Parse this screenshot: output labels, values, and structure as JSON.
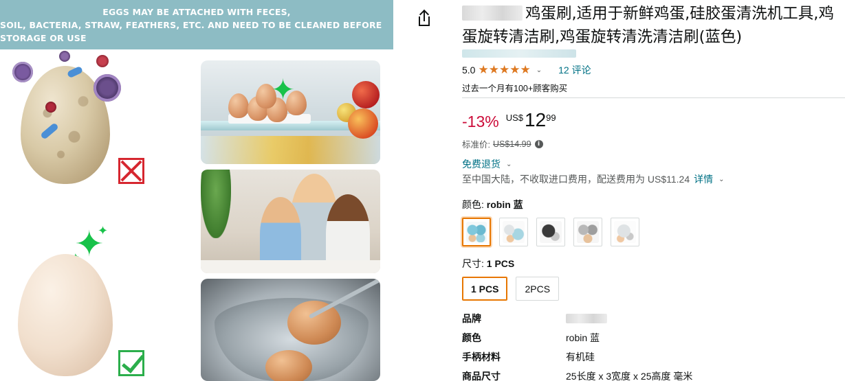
{
  "image": {
    "banner_line1": "EGGS MAY BE ATTACHED WITH FECES,",
    "banner_line2": "SOIL, BACTERIA, STRAW, FEATHERS, ETC. AND NEED TO BE CLEANED BEFORE STORAGE OR USE",
    "colors": {
      "banner": "#8dbcc4",
      "wrong_mark": "#d6262f",
      "right_mark": "#2bae4b",
      "sparkle": "#18c24a"
    }
  },
  "header": {
    "share_icon": "share-icon",
    "title": "鸡蛋刷,适用于新鲜鸡蛋,硅胶蛋清洗机工具,鸡蛋旋转清洁刷,鸡蛋旋转清洗清洁刷(蓝色)"
  },
  "rating": {
    "value": "5.0",
    "stars": 5,
    "star_glyph": "★",
    "chevron": "⌄",
    "reviews_text": "12 评论",
    "bought_text": "过去一个月有100+顾客购买"
  },
  "price": {
    "discount": "-13%",
    "currency": "US$",
    "whole": "12",
    "fraction": "99",
    "list_label": "标准价:",
    "list_price": "US$14.99",
    "info_icon": "i"
  },
  "delivery": {
    "returns_text": "免费退货",
    "chevron": "⌄",
    "shipping_text": "至中国大陆，不收取进口费用，配送费用为 US$11.24",
    "details_link": "详情"
  },
  "color_variant": {
    "label": "颜色:",
    "selected": "robin 蓝",
    "swatch_names": [
      "robin 蓝",
      "white",
      "black",
      "gray",
      "clear"
    ]
  },
  "size_variant": {
    "label": "尺寸:",
    "selected": "1 PCS",
    "options": [
      "1 PCS",
      "2PCS"
    ]
  },
  "specs": [
    {
      "key": "品牌",
      "value": ""
    },
    {
      "key": "颜色",
      "value": "robin 蓝"
    },
    {
      "key": "手柄材料",
      "value": "有机硅"
    },
    {
      "key": "商品尺寸",
      "value": "25长度 x 3宽度 x 25高度 毫米"
    }
  ],
  "accent_colors": {
    "link": "#007185",
    "deal_red": "#cc0c39",
    "star_orange": "#de7921",
    "selected_border": "#e77600"
  }
}
